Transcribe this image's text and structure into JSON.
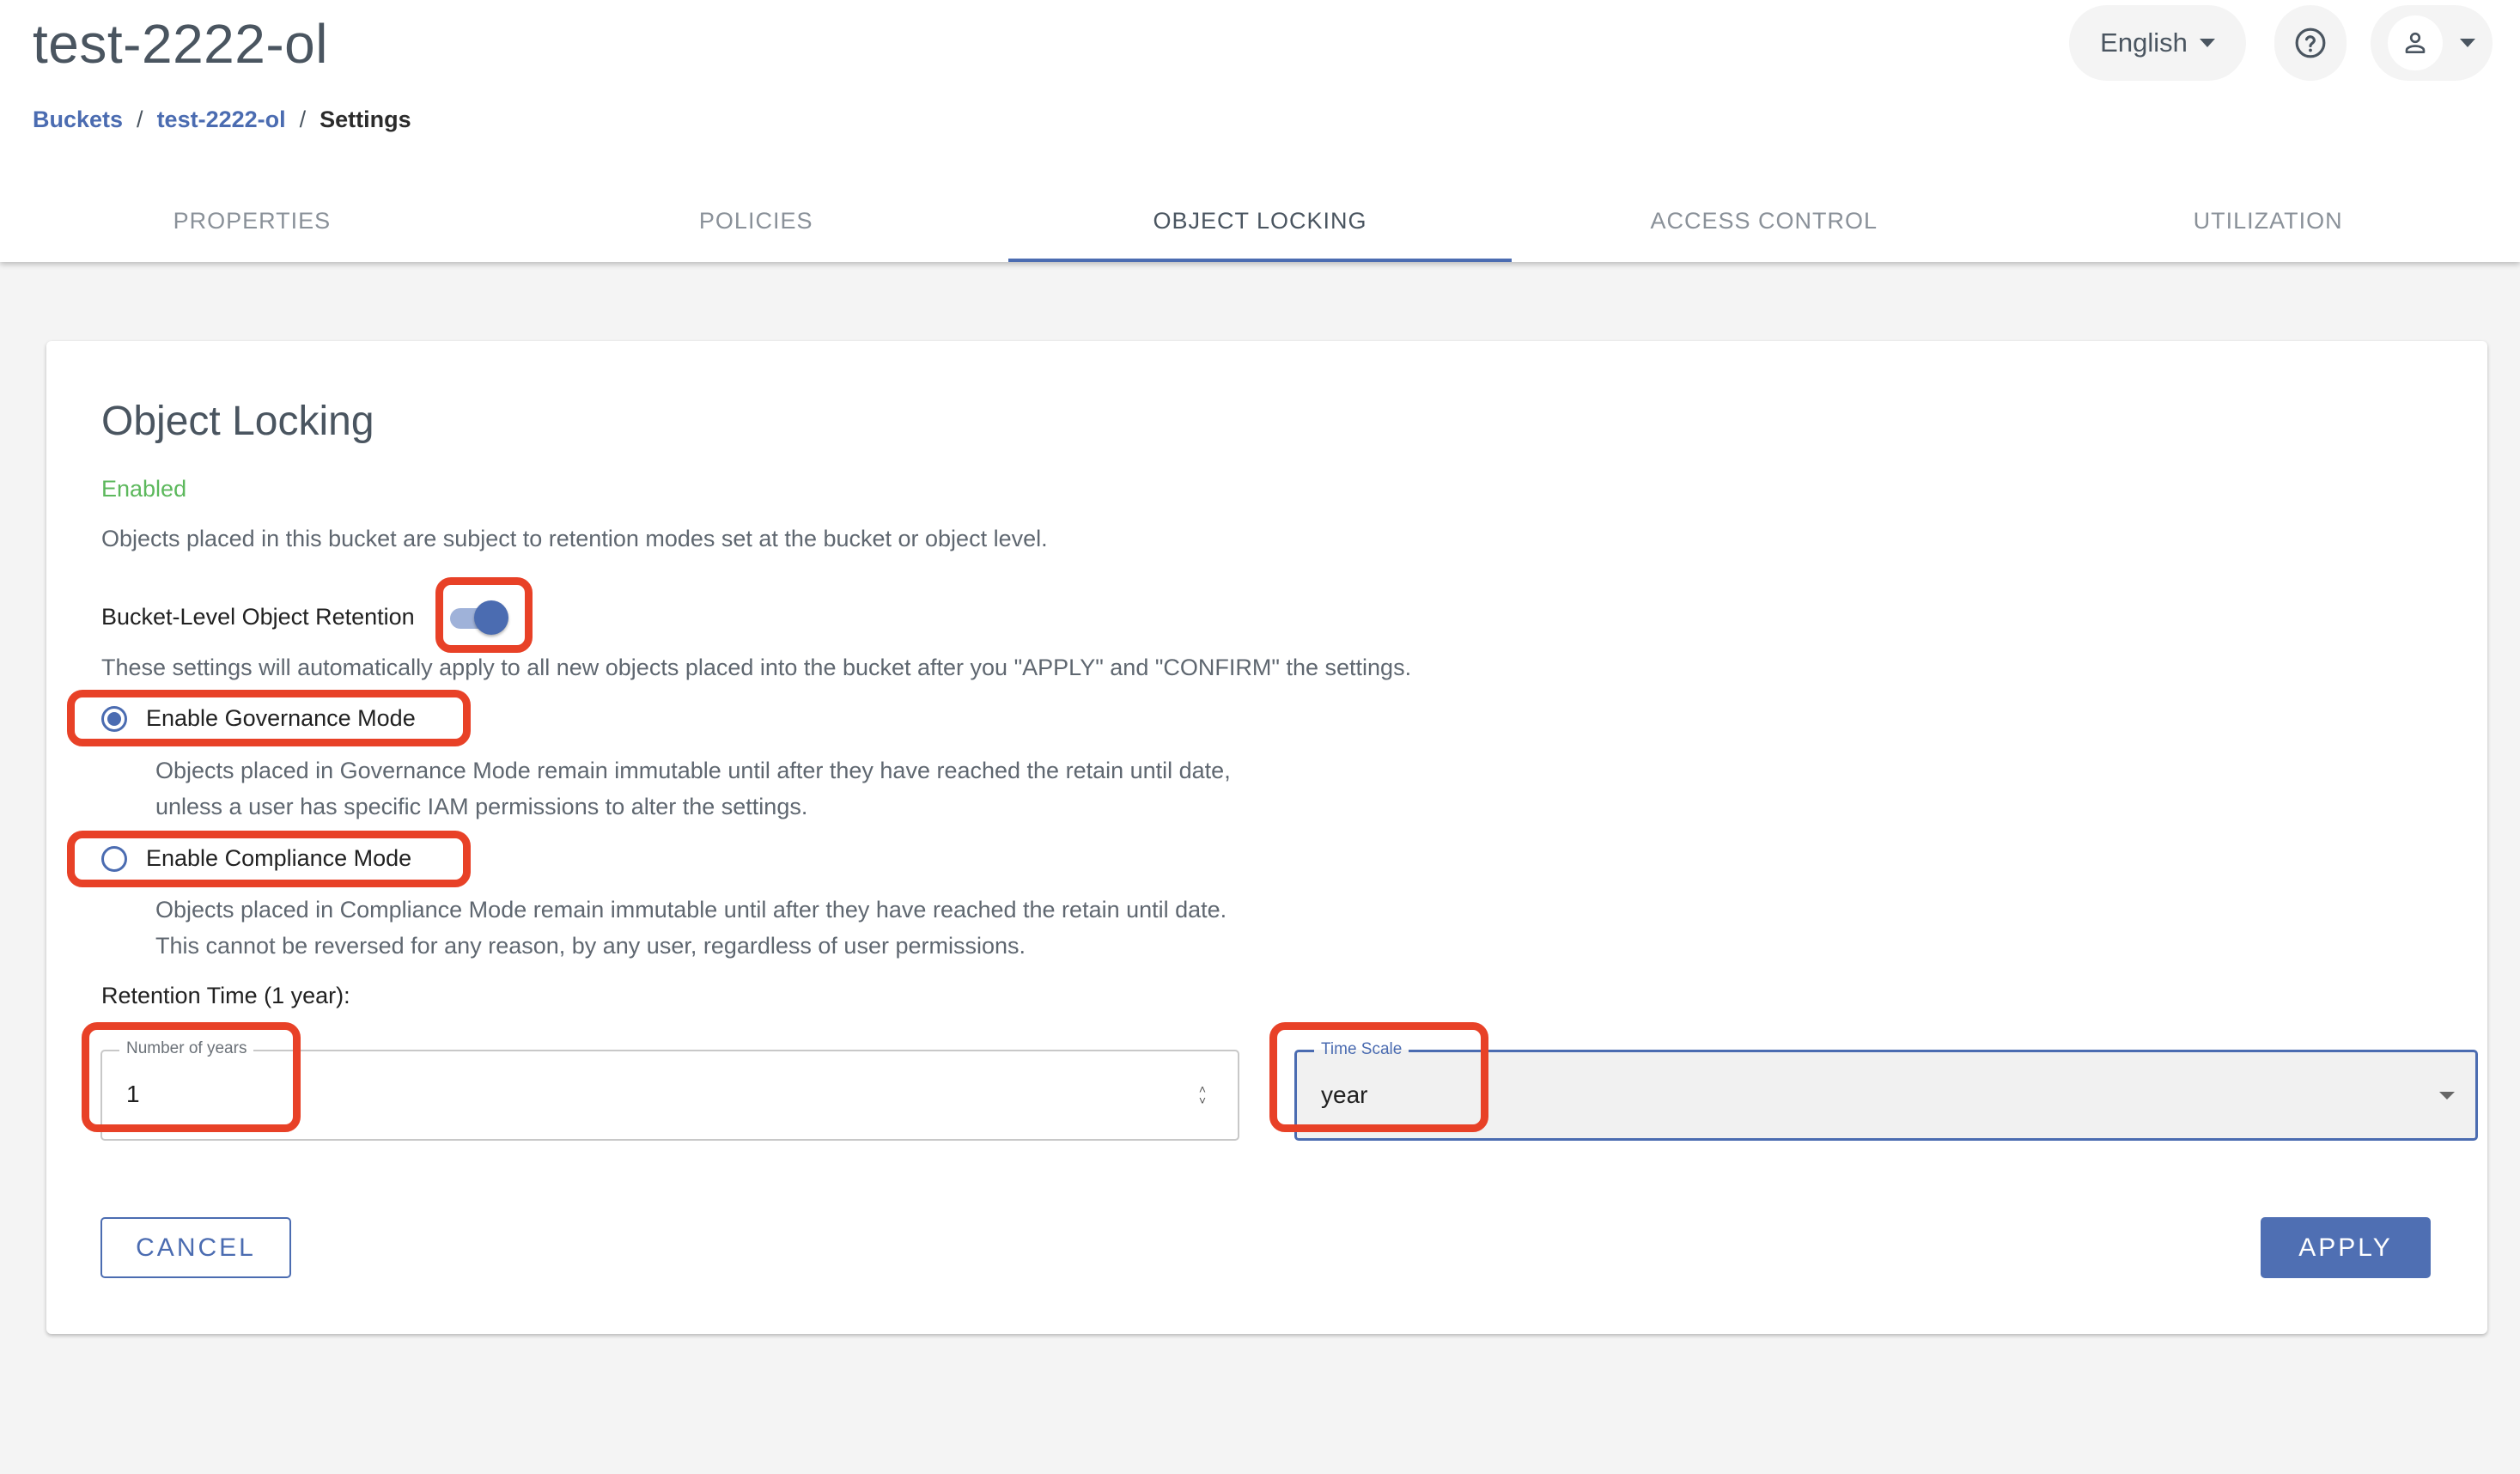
{
  "header": {
    "title": "test-2222-ol",
    "breadcrumb": [
      {
        "label": "Buckets"
      },
      {
        "label": "test-2222-ol"
      },
      {
        "label": "Settings"
      }
    ],
    "breadcrumb_separator": "/",
    "language": "English",
    "help_icon": "help-circle-icon",
    "user_icon": "person-icon"
  },
  "tabs": [
    {
      "label": "PROPERTIES",
      "active": false
    },
    {
      "label": "POLICIES",
      "active": false
    },
    {
      "label": "OBJECT LOCKING",
      "active": true
    },
    {
      "label": "ACCESS CONTROL",
      "active": false
    },
    {
      "label": "UTILIZATION",
      "active": false
    }
  ],
  "card": {
    "title": "Object Locking",
    "status": "Enabled",
    "description": "Objects placed in this bucket are subject to retention modes set at the bucket or object level.",
    "retention_toggle": {
      "label": "Bucket-Level Object Retention",
      "on": true
    },
    "settings_note": "These settings will automatically apply to all new objects placed into the bucket after you \"APPLY\" and \"CONFIRM\" the settings.",
    "modes": [
      {
        "label": "Enable Governance Mode",
        "selected": true,
        "description_lines": [
          "Objects placed in Governance Mode remain immutable until after they have reached the retain until date,",
          "unless a user has specific IAM permissions to alter the settings."
        ]
      },
      {
        "label": "Enable Compliance Mode",
        "selected": false,
        "description_lines": [
          "Objects placed in Compliance Mode remain immutable until after they have reached the retain until date.",
          "This cannot be reversed for any reason, by any user, regardless of user permissions."
        ]
      }
    ],
    "retention_label": "Retention Time (1 year):",
    "number_field": {
      "label": "Number of years",
      "value": "1"
    },
    "timescale_field": {
      "label": "Time Scale",
      "value": "year"
    },
    "cancel_label": "CANCEL",
    "apply_label": "APPLY"
  },
  "colors": {
    "accent": "#4b6cb1",
    "enabled": "#5cb85c",
    "highlight": "#e84127",
    "background": "#f4f4f4"
  }
}
